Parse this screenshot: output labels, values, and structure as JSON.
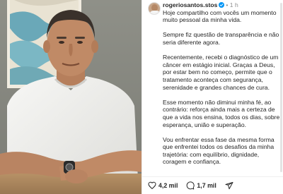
{
  "post": {
    "username": "rogeriosantos.stos",
    "separator": "•",
    "time": "1 h",
    "caption": [
      "Hoje compartilho com vocês um momento muito pessoal da minha vida.",
      "Sempre fiz questão de transparência e não seria diferente agora.",
      "Recentemente, recebi o diagnóstico de um câncer em estágio inicial. Graças a Deus, por estar bem no começo, permite que o tratamento aconteça com segurança, serenidade e grandes chances de cura.",
      "Esse momento não diminui minha fé, ao contrário: reforça ainda mais a certeza de que a vida nos ensina, todos os dias, sobre esperança, união e superação.",
      "Vou enfrentar essa fase da mesma forma que enfrentei todos os desafios da minha trajetória: com equilíbrio, dignidade, coragem e confiança."
    ]
  },
  "actions": {
    "likes": "4,2 mil",
    "comments": "1,7 mil"
  },
  "icons": {
    "avatar": "profile-photo",
    "verified": "verified-badge-icon",
    "like": "heart-icon",
    "comment": "comment-bubble-icon",
    "share": "send-icon"
  },
  "colors": {
    "verified": "#0095f6",
    "text": "#262626",
    "muted": "#8e8e8e"
  }
}
